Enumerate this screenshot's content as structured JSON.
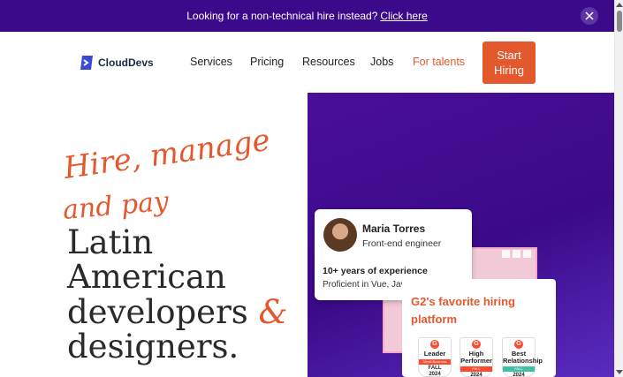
{
  "banner": {
    "text": "Looking for a non-technical hire instead?",
    "link": "Click here"
  },
  "nav": {
    "logo_text": "CloudDevs",
    "links": [
      "Services",
      "Pricing",
      "Resources",
      "Jobs",
      "For talents"
    ],
    "cta": "Start Hiring"
  },
  "hero": {
    "script_line1": "Hire, manage",
    "script_line2": "and pay",
    "line1": "Latin",
    "line2": "American",
    "line3": "developers",
    "amp": "&",
    "line4": "designers."
  },
  "profile": {
    "name": "Maria Torres",
    "role": "Front-end engineer",
    "experience": "10+ years of experience",
    "skills": "Proficient in Vue, Java & Python"
  },
  "g2": {
    "title": "G2's favorite hiring platform",
    "badges": [
      {
        "title": "Leader",
        "band": "Small Business",
        "season": "FALL",
        "year": "2024",
        "color": "#ff492c"
      },
      {
        "title": "High Performer",
        "band": "FALL",
        "season": "",
        "year": "2024",
        "color": "#ff492c"
      },
      {
        "title": "Best Relationship",
        "band": "FALL",
        "season": "",
        "year": "2024",
        "color": "#3cc0a6"
      }
    ]
  },
  "colors": {
    "banner": "#3a0a8a",
    "accent": "#e4582e",
    "panel": "#4a0e9a"
  }
}
